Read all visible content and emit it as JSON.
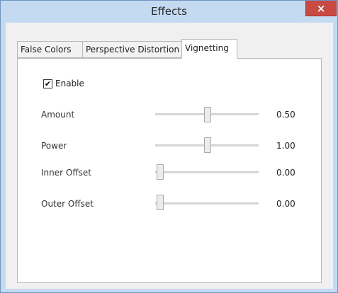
{
  "window": {
    "title": "Effects",
    "close_glyph": "×",
    "title_bar_color": "#c4daf0",
    "close_color": "#c94a42"
  },
  "tabs": [
    {
      "label": "False Colors",
      "active": false
    },
    {
      "label": "Perspective Distortion",
      "active": false
    },
    {
      "label": "Vignetting",
      "active": true
    }
  ],
  "vignetting": {
    "enable": {
      "label": "Enable",
      "checked": true,
      "check_glyph": "✔"
    },
    "sliders": [
      {
        "label": "Amount",
        "value": "0.50",
        "position": 0.5
      },
      {
        "label": "Power",
        "value": "1.00",
        "position": 0.5
      },
      {
        "label": "Inner Offset",
        "value": "0.00",
        "position": 0.0
      },
      {
        "label": "Outer Offset",
        "value": "0.00",
        "position": 0.0
      }
    ]
  }
}
